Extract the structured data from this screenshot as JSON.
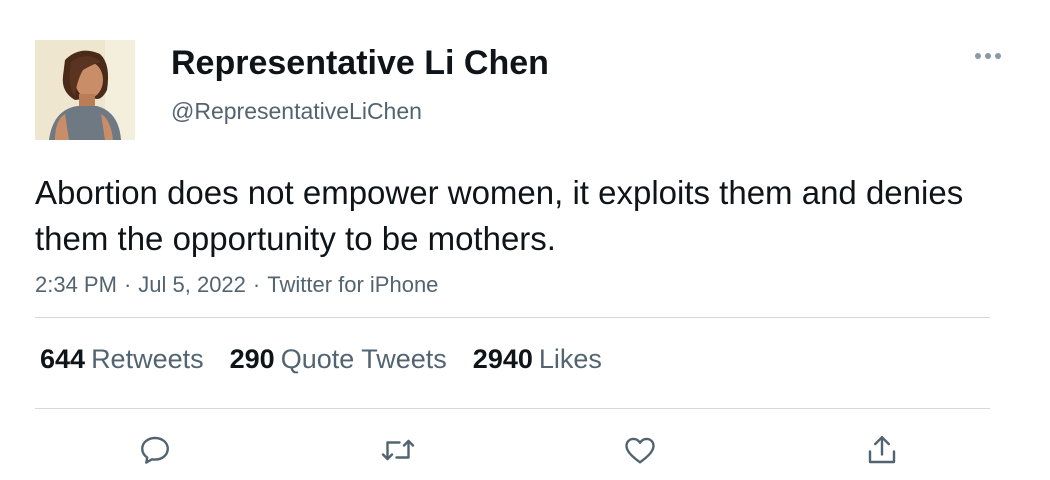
{
  "author": {
    "display_name": "Representative Li Chen",
    "handle": "@RepresentativeLiChen"
  },
  "tweet": {
    "text": "Abortion does not empower women, it exploits them and denies them the opportunity to be mothers.",
    "time": "2:34 PM",
    "date": "Jul 5, 2022",
    "source": "Twitter for iPhone",
    "separator": "·"
  },
  "stats": {
    "retweets_count": "644",
    "retweets_label": "Retweets",
    "quotes_count": "290",
    "quotes_label": "Quote Tweets",
    "likes_count": "2940",
    "likes_label": "Likes"
  },
  "icons": {
    "more": "more-horizontal-icon",
    "reply": "reply-icon",
    "retweet": "retweet-icon",
    "like": "heart-icon",
    "share": "share-icon"
  },
  "colors": {
    "text_primary": "#0f1419",
    "text_secondary": "#536471",
    "divider": "#cfd9de"
  }
}
